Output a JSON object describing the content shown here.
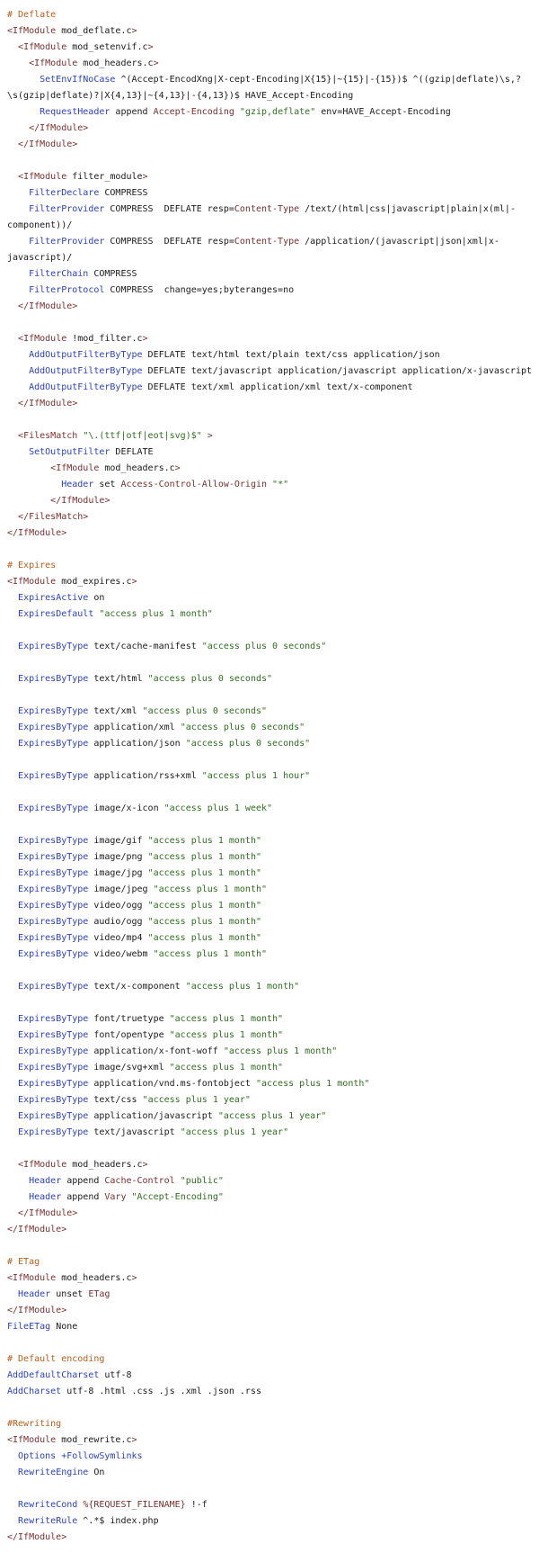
{
  "lines": [
    [
      [
        "comment",
        "# Deflate"
      ]
    ],
    [
      [
        "tag",
        "<IfModule"
      ],
      [
        "plain",
        " mod_deflate.c"
      ],
      [
        "tag",
        ">"
      ]
    ],
    [
      [
        "plain",
        "  "
      ],
      [
        "tag",
        "<IfModule"
      ],
      [
        "plain",
        " mod_setenvif.c"
      ],
      [
        "tag",
        ">"
      ]
    ],
    [
      [
        "plain",
        "    "
      ],
      [
        "tag",
        "<IfModule"
      ],
      [
        "plain",
        " mod_headers.c"
      ],
      [
        "tag",
        ">"
      ]
    ],
    [
      [
        "plain",
        "      "
      ],
      [
        "dir",
        "SetEnvIfNoCase"
      ],
      [
        "plain",
        " ^(Accept-EncodXng|X-cept-Encoding|X{15}|~{15}|-{15})$ ^((gzip|deflate)\\s,?"
      ]
    ],
    [
      [
        "plain",
        "\\s(gzip|deflate)?|X{4,13}|~{4,13}|-{4,13})$ HAVE_Accept-Encoding"
      ]
    ],
    [
      [
        "plain",
        "      "
      ],
      [
        "dir",
        "RequestHeader"
      ],
      [
        "plain",
        " append "
      ],
      [
        "var",
        "Accept-Encoding"
      ],
      [
        "plain",
        " "
      ],
      [
        "str",
        "\"gzip,deflate\""
      ],
      [
        "plain",
        " env=HAVE_Accept-Encoding"
      ]
    ],
    [
      [
        "plain",
        "    "
      ],
      [
        "tag",
        "</IfModule>"
      ]
    ],
    [
      [
        "plain",
        "  "
      ],
      [
        "tag",
        "</IfModule>"
      ]
    ],
    [
      [
        "plain",
        ""
      ]
    ],
    [
      [
        "plain",
        "  "
      ],
      [
        "tag",
        "<IfModule"
      ],
      [
        "plain",
        " filter_module"
      ],
      [
        "tag",
        ">"
      ]
    ],
    [
      [
        "plain",
        "    "
      ],
      [
        "dir",
        "FilterDeclare"
      ],
      [
        "plain",
        " COMPRESS"
      ]
    ],
    [
      [
        "plain",
        "    "
      ],
      [
        "dir",
        "FilterProvider"
      ],
      [
        "plain",
        " COMPRESS  DEFLATE resp="
      ],
      [
        "var",
        "Content-Type"
      ],
      [
        "plain",
        " /text/(html|css|javascript|plain|x(ml|-"
      ]
    ],
    [
      [
        "plain",
        "component))/"
      ]
    ],
    [
      [
        "plain",
        "    "
      ],
      [
        "dir",
        "FilterProvider"
      ],
      [
        "plain",
        " COMPRESS  DEFLATE resp="
      ],
      [
        "var",
        "Content-Type"
      ],
      [
        "plain",
        " /application/(javascript|json|xml|x-"
      ]
    ],
    [
      [
        "plain",
        "javascript)/"
      ]
    ],
    [
      [
        "plain",
        "    "
      ],
      [
        "dir",
        "FilterChain"
      ],
      [
        "plain",
        " COMPRESS"
      ]
    ],
    [
      [
        "plain",
        "    "
      ],
      [
        "dir",
        "FilterProtocol"
      ],
      [
        "plain",
        " COMPRESS  change=yes;byteranges=no"
      ]
    ],
    [
      [
        "plain",
        "  "
      ],
      [
        "tag",
        "</IfModule>"
      ]
    ],
    [
      [
        "plain",
        ""
      ]
    ],
    [
      [
        "plain",
        "  "
      ],
      [
        "tag",
        "<IfModule"
      ],
      [
        "plain",
        " !mod_filter.c"
      ],
      [
        "tag",
        ">"
      ]
    ],
    [
      [
        "plain",
        "    "
      ],
      [
        "dir",
        "AddOutputFilterByType"
      ],
      [
        "plain",
        " DEFLATE text/html text/plain text/css application/json"
      ]
    ],
    [
      [
        "plain",
        "    "
      ],
      [
        "dir",
        "AddOutputFilterByType"
      ],
      [
        "plain",
        " DEFLATE text/javascript application/javascript application/x-javascript"
      ]
    ],
    [
      [
        "plain",
        "    "
      ],
      [
        "dir",
        "AddOutputFilterByType"
      ],
      [
        "plain",
        " DEFLATE text/xml application/xml text/x-component"
      ]
    ],
    [
      [
        "plain",
        "  "
      ],
      [
        "tag",
        "</IfModule>"
      ]
    ],
    [
      [
        "plain",
        ""
      ]
    ],
    [
      [
        "plain",
        "  "
      ],
      [
        "tag",
        "<FilesMatch"
      ],
      [
        "plain",
        " "
      ],
      [
        "str",
        "\"\\.(ttf|otf|eot|svg)$\""
      ],
      [
        "plain",
        " "
      ],
      [
        "tag",
        ">"
      ]
    ],
    [
      [
        "plain",
        "    "
      ],
      [
        "dir",
        "SetOutputFilter"
      ],
      [
        "plain",
        " DEFLATE"
      ]
    ],
    [
      [
        "plain",
        "        "
      ],
      [
        "tag",
        "<IfModule"
      ],
      [
        "plain",
        " mod_headers.c"
      ],
      [
        "tag",
        ">"
      ]
    ],
    [
      [
        "plain",
        "          "
      ],
      [
        "dir",
        "Header"
      ],
      [
        "plain",
        " set "
      ],
      [
        "var",
        "Access-Control-Allow-Origin"
      ],
      [
        "plain",
        " "
      ],
      [
        "str",
        "\"*\""
      ]
    ],
    [
      [
        "plain",
        "        "
      ],
      [
        "tag",
        "</IfModule>"
      ]
    ],
    [
      [
        "plain",
        "  "
      ],
      [
        "tag",
        "</FilesMatch>"
      ]
    ],
    [
      [
        "tag",
        "</IfModule>"
      ]
    ],
    [
      [
        "plain",
        ""
      ]
    ],
    [
      [
        "comment",
        "# Expires"
      ]
    ],
    [
      [
        "tag",
        "<IfModule"
      ],
      [
        "plain",
        " mod_expires.c"
      ],
      [
        "tag",
        ">"
      ]
    ],
    [
      [
        "plain",
        "  "
      ],
      [
        "dir",
        "ExpiresActive"
      ],
      [
        "plain",
        " on"
      ]
    ],
    [
      [
        "plain",
        "  "
      ],
      [
        "dir",
        "ExpiresDefault"
      ],
      [
        "plain",
        " "
      ],
      [
        "str",
        "\"access plus 1 month\""
      ]
    ],
    [
      [
        "plain",
        ""
      ]
    ],
    [
      [
        "plain",
        "  "
      ],
      [
        "dir",
        "ExpiresByType"
      ],
      [
        "plain",
        " text/cache-manifest "
      ],
      [
        "str",
        "\"access plus 0 seconds\""
      ]
    ],
    [
      [
        "plain",
        ""
      ]
    ],
    [
      [
        "plain",
        "  "
      ],
      [
        "dir",
        "ExpiresByType"
      ],
      [
        "plain",
        " text/html "
      ],
      [
        "str",
        "\"access plus 0 seconds\""
      ]
    ],
    [
      [
        "plain",
        ""
      ]
    ],
    [
      [
        "plain",
        "  "
      ],
      [
        "dir",
        "ExpiresByType"
      ],
      [
        "plain",
        " text/xml "
      ],
      [
        "str",
        "\"access plus 0 seconds\""
      ]
    ],
    [
      [
        "plain",
        "  "
      ],
      [
        "dir",
        "ExpiresByType"
      ],
      [
        "plain",
        " application/xml "
      ],
      [
        "str",
        "\"access plus 0 seconds\""
      ]
    ],
    [
      [
        "plain",
        "  "
      ],
      [
        "dir",
        "ExpiresByType"
      ],
      [
        "plain",
        " application/json "
      ],
      [
        "str",
        "\"access plus 0 seconds\""
      ]
    ],
    [
      [
        "plain",
        ""
      ]
    ],
    [
      [
        "plain",
        "  "
      ],
      [
        "dir",
        "ExpiresByType"
      ],
      [
        "plain",
        " application/rss+xml "
      ],
      [
        "str",
        "\"access plus 1 hour\""
      ]
    ],
    [
      [
        "plain",
        ""
      ]
    ],
    [
      [
        "plain",
        "  "
      ],
      [
        "dir",
        "ExpiresByType"
      ],
      [
        "plain",
        " image/x-icon "
      ],
      [
        "str",
        "\"access plus 1 week\""
      ]
    ],
    [
      [
        "plain",
        ""
      ]
    ],
    [
      [
        "plain",
        "  "
      ],
      [
        "dir",
        "ExpiresByType"
      ],
      [
        "plain",
        " image/gif "
      ],
      [
        "str",
        "\"access plus 1 month\""
      ]
    ],
    [
      [
        "plain",
        "  "
      ],
      [
        "dir",
        "ExpiresByType"
      ],
      [
        "plain",
        " image/png "
      ],
      [
        "str",
        "\"access plus 1 month\""
      ]
    ],
    [
      [
        "plain",
        "  "
      ],
      [
        "dir",
        "ExpiresByType"
      ],
      [
        "plain",
        " image/jpg "
      ],
      [
        "str",
        "\"access plus 1 month\""
      ]
    ],
    [
      [
        "plain",
        "  "
      ],
      [
        "dir",
        "ExpiresByType"
      ],
      [
        "plain",
        " image/jpeg "
      ],
      [
        "str",
        "\"access plus 1 month\""
      ]
    ],
    [
      [
        "plain",
        "  "
      ],
      [
        "dir",
        "ExpiresByType"
      ],
      [
        "plain",
        " video/ogg "
      ],
      [
        "str",
        "\"access plus 1 month\""
      ]
    ],
    [
      [
        "plain",
        "  "
      ],
      [
        "dir",
        "ExpiresByType"
      ],
      [
        "plain",
        " audio/ogg "
      ],
      [
        "str",
        "\"access plus 1 month\""
      ]
    ],
    [
      [
        "plain",
        "  "
      ],
      [
        "dir",
        "ExpiresByType"
      ],
      [
        "plain",
        " video/mp4 "
      ],
      [
        "str",
        "\"access plus 1 month\""
      ]
    ],
    [
      [
        "plain",
        "  "
      ],
      [
        "dir",
        "ExpiresByType"
      ],
      [
        "plain",
        " video/webm "
      ],
      [
        "str",
        "\"access plus 1 month\""
      ]
    ],
    [
      [
        "plain",
        ""
      ]
    ],
    [
      [
        "plain",
        "  "
      ],
      [
        "dir",
        "ExpiresByType"
      ],
      [
        "plain",
        " text/x-component "
      ],
      [
        "str",
        "\"access plus 1 month\""
      ]
    ],
    [
      [
        "plain",
        ""
      ]
    ],
    [
      [
        "plain",
        "  "
      ],
      [
        "dir",
        "ExpiresByType"
      ],
      [
        "plain",
        " font/truetype "
      ],
      [
        "str",
        "\"access plus 1 month\""
      ]
    ],
    [
      [
        "plain",
        "  "
      ],
      [
        "dir",
        "ExpiresByType"
      ],
      [
        "plain",
        " font/opentype "
      ],
      [
        "str",
        "\"access plus 1 month\""
      ]
    ],
    [
      [
        "plain",
        "  "
      ],
      [
        "dir",
        "ExpiresByType"
      ],
      [
        "plain",
        " application/x-font-woff "
      ],
      [
        "str",
        "\"access plus 1 month\""
      ]
    ],
    [
      [
        "plain",
        "  "
      ],
      [
        "dir",
        "ExpiresByType"
      ],
      [
        "plain",
        " image/svg+xml "
      ],
      [
        "str",
        "\"access plus 1 month\""
      ]
    ],
    [
      [
        "plain",
        "  "
      ],
      [
        "dir",
        "ExpiresByType"
      ],
      [
        "plain",
        " application/vnd.ms-fontobject "
      ],
      [
        "str",
        "\"access plus 1 month\""
      ]
    ],
    [
      [
        "plain",
        "  "
      ],
      [
        "dir",
        "ExpiresByType"
      ],
      [
        "plain",
        " text/css "
      ],
      [
        "str",
        "\"access plus 1 year\""
      ]
    ],
    [
      [
        "plain",
        "  "
      ],
      [
        "dir",
        "ExpiresByType"
      ],
      [
        "plain",
        " application/javascript "
      ],
      [
        "str",
        "\"access plus 1 year\""
      ]
    ],
    [
      [
        "plain",
        "  "
      ],
      [
        "dir",
        "ExpiresByType"
      ],
      [
        "plain",
        " text/javascript "
      ],
      [
        "str",
        "\"access plus 1 year\""
      ]
    ],
    [
      [
        "plain",
        ""
      ]
    ],
    [
      [
        "plain",
        "  "
      ],
      [
        "tag",
        "<IfModule"
      ],
      [
        "plain",
        " mod_headers.c"
      ],
      [
        "tag",
        ">"
      ]
    ],
    [
      [
        "plain",
        "    "
      ],
      [
        "dir",
        "Header"
      ],
      [
        "plain",
        " append "
      ],
      [
        "var",
        "Cache-Control"
      ],
      [
        "plain",
        " "
      ],
      [
        "str",
        "\"public\""
      ]
    ],
    [
      [
        "plain",
        "    "
      ],
      [
        "dir",
        "Header"
      ],
      [
        "plain",
        " append "
      ],
      [
        "var",
        "Vary"
      ],
      [
        "plain",
        " "
      ],
      [
        "str",
        "\"Accept-Encoding\""
      ]
    ],
    [
      [
        "plain",
        "  "
      ],
      [
        "tag",
        "</IfModule>"
      ]
    ],
    [
      [
        "tag",
        "</IfModule>"
      ]
    ],
    [
      [
        "plain",
        ""
      ]
    ],
    [
      [
        "comment",
        "# ETag"
      ]
    ],
    [
      [
        "tag",
        "<IfModule"
      ],
      [
        "plain",
        " mod_headers.c"
      ],
      [
        "tag",
        ">"
      ]
    ],
    [
      [
        "plain",
        "  "
      ],
      [
        "dir",
        "Header"
      ],
      [
        "plain",
        " unset "
      ],
      [
        "var",
        "ETag"
      ]
    ],
    [
      [
        "tag",
        "</IfModule>"
      ]
    ],
    [
      [
        "dir",
        "FileETag"
      ],
      [
        "plain",
        " None"
      ]
    ],
    [
      [
        "plain",
        ""
      ]
    ],
    [
      [
        "comment",
        "# Default encoding"
      ]
    ],
    [
      [
        "dir",
        "AddDefaultCharset"
      ],
      [
        "plain",
        " utf-8"
      ]
    ],
    [
      [
        "dir",
        "AddCharset"
      ],
      [
        "plain",
        " utf-8 .html .css .js .xml .json .rss"
      ]
    ],
    [
      [
        "plain",
        ""
      ]
    ],
    [
      [
        "comment",
        "#Rewriting"
      ]
    ],
    [
      [
        "tag",
        "<IfModule"
      ],
      [
        "plain",
        " mod_rewrite.c"
      ],
      [
        "tag",
        ">"
      ]
    ],
    [
      [
        "plain",
        "  "
      ],
      [
        "dir",
        "Options"
      ],
      [
        "plain",
        " "
      ],
      [
        "dir",
        "+FollowSymlinks"
      ]
    ],
    [
      [
        "plain",
        "  "
      ],
      [
        "dir",
        "RewriteEngine"
      ],
      [
        "plain",
        " On"
      ]
    ],
    [
      [
        "plain",
        ""
      ]
    ],
    [
      [
        "plain",
        "  "
      ],
      [
        "dir",
        "RewriteCond"
      ],
      [
        "plain",
        " "
      ],
      [
        "var",
        "%{REQUEST_FILENAME}"
      ],
      [
        "plain",
        " !-f"
      ]
    ],
    [
      [
        "plain",
        "  "
      ],
      [
        "dir",
        "RewriteRule"
      ],
      [
        "plain",
        " ^.*$ index.php"
      ]
    ],
    [
      [
        "tag",
        "</IfModule>"
      ]
    ]
  ]
}
